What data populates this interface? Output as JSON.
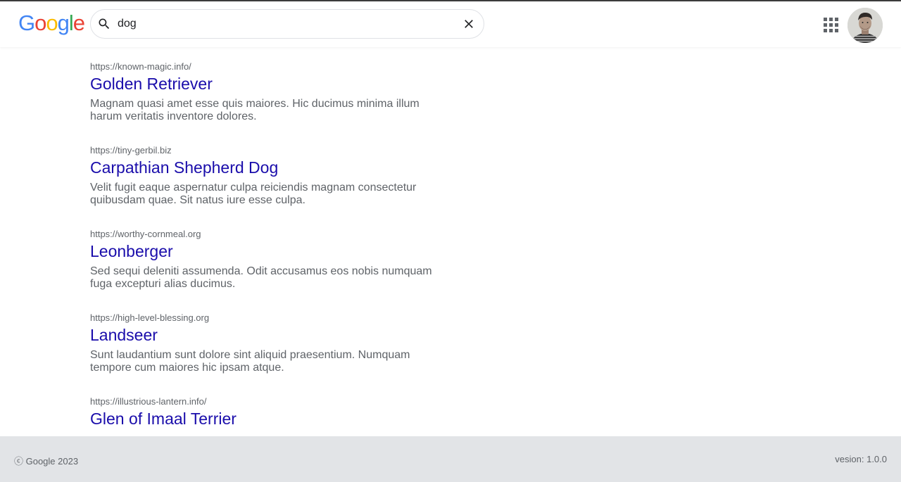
{
  "header": {
    "logo_letters": [
      "G",
      "o",
      "o",
      "g",
      "l",
      "e"
    ],
    "logo_colors": [
      "#4285F4",
      "#EA4335",
      "#FBBC05",
      "#4285F4",
      "#34A853",
      "#EA4335"
    ],
    "search": {
      "value": "dog",
      "placeholder": ""
    },
    "icons": {
      "search": "search-icon",
      "clear": "close-icon",
      "apps": "apps-grid-icon",
      "avatar": "user-avatar"
    }
  },
  "results": [
    {
      "url": "https://known-magic.info/",
      "title": "Golden Retriever",
      "snippet": "Magnam quasi amet esse quis maiores. Hic ducimus minima illum harum veritatis inventore dolores."
    },
    {
      "url": "https://tiny-gerbil.biz",
      "title": "Carpathian Shepherd Dog",
      "snippet": "Velit fugit eaque aspernatur culpa reiciendis magnam consectetur quibusdam quae. Sit natus iure esse culpa."
    },
    {
      "url": "https://worthy-cornmeal.org",
      "title": "Leonberger",
      "snippet": "Sed sequi deleniti assumenda. Odit accusamus eos nobis numquam fuga excepturi alias ducimus."
    },
    {
      "url": "https://high-level-blessing.org",
      "title": "Landseer",
      "snippet": "Sunt laudantium sunt dolore sint aliquid praesentium. Numquam tempore cum maiores hic ipsam atque."
    },
    {
      "url": "https://illustrious-lantern.info/",
      "title": "Glen of Imaal Terrier",
      "snippet": ""
    }
  ],
  "footer": {
    "copyright": "ⓒ Google 2023",
    "version": "vesion: 1.0.0"
  },
  "colors": {
    "link": "#1a0dab",
    "muted": "#5f6368",
    "footer_bg": "#e2e4e7"
  }
}
